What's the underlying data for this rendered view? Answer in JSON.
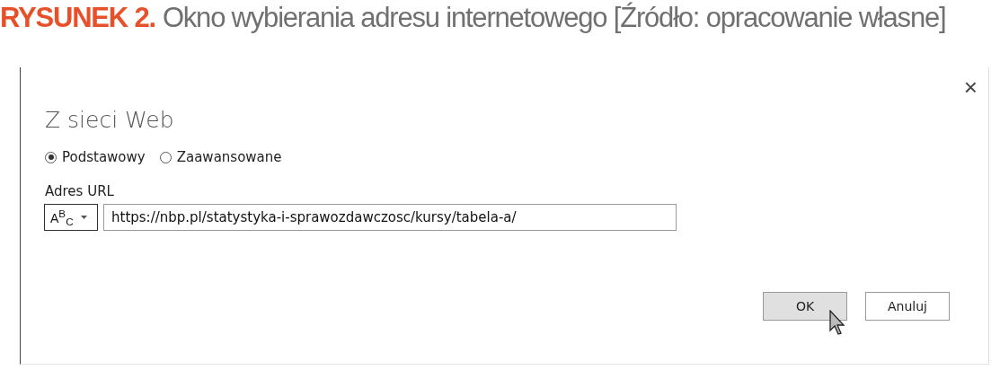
{
  "caption": {
    "number": "RYSUNEK 2.",
    "text": "Okno wybierania adresu internetowego [Źródło: opracowanie własne]"
  },
  "dialog": {
    "close": "×",
    "title": "Z sieci Web",
    "modes": [
      {
        "label": "Podstawowy",
        "selected": true
      },
      {
        "label": "Zaawansowane",
        "selected": false
      }
    ],
    "url_label": "Adres URL",
    "type_button": "A$^{B}$$_{C}$",
    "url_value": "https://nbp.pl/statystyka-i-sprawozdawczosc/kursy/tabela-a/",
    "buttons": [
      {
        "label": "OK",
        "hovered": true
      },
      {
        "label": "Anuluj",
        "hovered": false
      }
    ]
  }
}
